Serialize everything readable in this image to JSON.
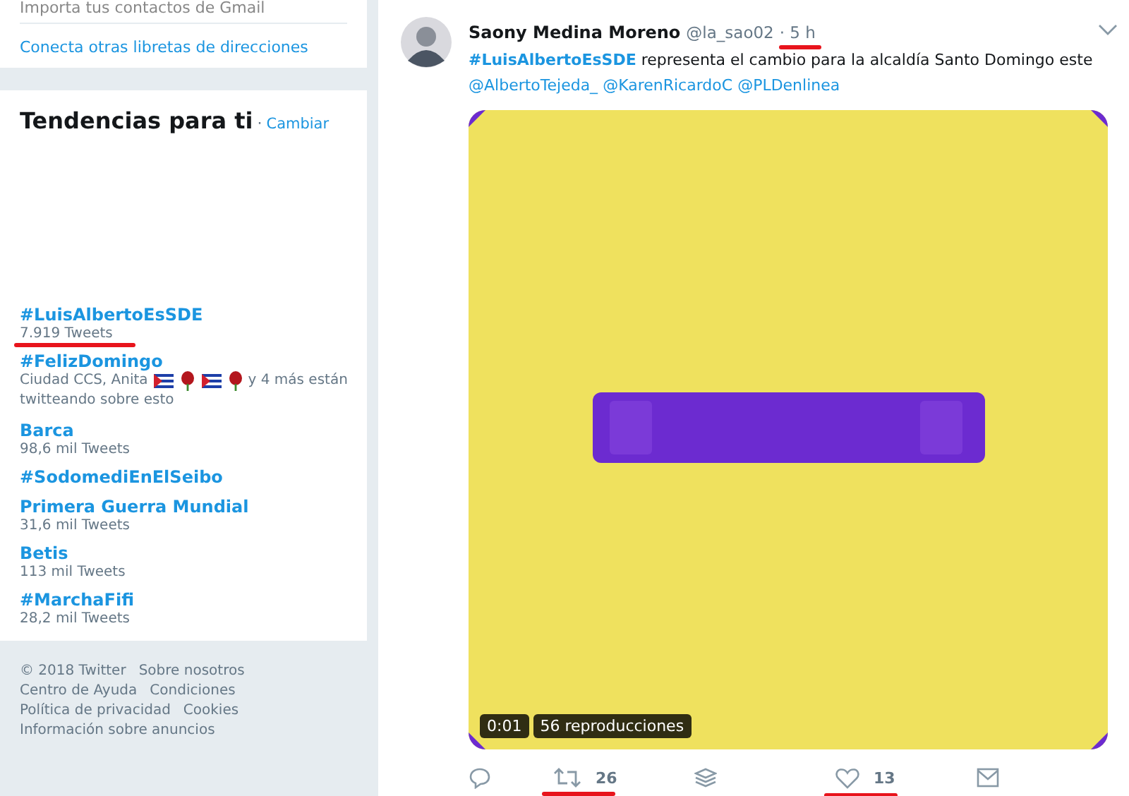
{
  "contacts_card": {
    "import_text": "Importa tus contactos de Gmail",
    "connect_link": "Conecta otras libretas de direcciones"
  },
  "trends": {
    "title": "Tendencias para ti",
    "separator": "·",
    "change_link": "Cambiar",
    "items": [
      {
        "name": "#LuisAlbertoEsSDE",
        "count": "7.919 Tweets",
        "annotated": true
      },
      {
        "name": "#FelizDomingo",
        "context_before": "Ciudad CCS, Anita",
        "context_after": "y 4 más están",
        "context_line2": "twitteando sobre esto",
        "annotated": false
      },
      {
        "name": "Barca",
        "count": "98,6 mil Tweets",
        "annotated": false
      },
      {
        "name": "#SodomediEnElSeibo",
        "annotated": false
      },
      {
        "name": "Primera Guerra Mundial",
        "count": "31,6 mil Tweets",
        "annotated": false
      },
      {
        "name": "Betis",
        "count": "113 mil Tweets",
        "annotated": false
      },
      {
        "name": "#MarchaFifi",
        "count": "28,2 mil Tweets",
        "annotated": false
      }
    ]
  },
  "footer": [
    "© 2018 Twitter",
    "Sobre nosotros",
    "Centro de Ayuda",
    "Condiciones",
    "Política de privacidad",
    "Cookies",
    "Información sobre anuncios"
  ],
  "tweet": {
    "author": "Saony Medina Moreno",
    "handle": "@la_sao02",
    "time": "· 5 h",
    "time_annotated": true,
    "hashtag": "#LuisAlbertoEsSDE",
    "text": "representa el cambio para la alcaldía Santo Domingo este",
    "mentions": [
      "@AlbertoTejeda_",
      "@KarenRicardoC",
      "@PLDenlinea"
    ],
    "media": {
      "kind": "picture",
      "duration": "0:01",
      "views": "56 reproducciones"
    },
    "actions": [
      {
        "kind": "reply"
      },
      {
        "kind": "retweet",
        "count": "26",
        "annotated": true
      },
      {
        "kind": "stack"
      },
      {
        "kind": "like",
        "count": "13",
        "annotated": true
      },
      {
        "kind": "message"
      }
    ]
  }
}
